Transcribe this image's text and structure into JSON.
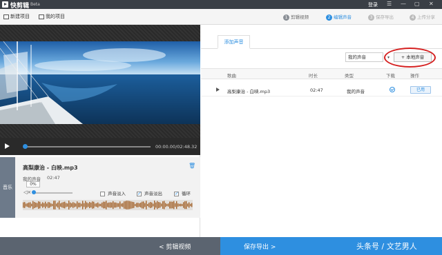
{
  "titlebar": {
    "app_name": "快剪辑",
    "badge": "Beta",
    "login": "登录",
    "controls": [
      "☰",
      "—",
      "▢",
      "✕"
    ]
  },
  "toolbar": {
    "new_project": "新建项目",
    "my_projects": "我的项目",
    "steps": [
      {
        "num": "1",
        "label": "剪辑视频",
        "state": "done"
      },
      {
        "num": "2",
        "label": "编辑声音",
        "state": "active"
      },
      {
        "num": "3",
        "label": "保存导出",
        "state": "disabled"
      },
      {
        "num": "4",
        "label": "上传分享",
        "state": "disabled"
      }
    ]
  },
  "player": {
    "time": "00:00.00/02:48.32"
  },
  "music_card": {
    "tab_label": "音乐",
    "title": "高梨康治 - 白映.mp3",
    "source": "我的声音",
    "duration": "02:47",
    "volume": "0%",
    "fade_in": {
      "label": "声音淡入",
      "checked": false
    },
    "fade_out": {
      "label": "声音淡出",
      "checked": true
    },
    "loop": {
      "label": "循环",
      "checked": true
    }
  },
  "right": {
    "tab": "添加声音",
    "filter_value": "我的声音",
    "local_button": "+ 本地声音",
    "columns": [
      "歌曲",
      "时长",
      "类型",
      "下载",
      "操作"
    ],
    "rows": [
      {
        "name": "高梨康治 - 白映.mp3",
        "duration": "02:47",
        "type": "我的声音",
        "action": "已用"
      }
    ]
  },
  "bottom": {
    "back": "< 剪辑视频",
    "next": "保存导出 >"
  },
  "watermark": "头条号 / 文艺男人",
  "colors": {
    "accent": "#2e8fe0",
    "highlight_ring": "#d52020",
    "titlebar": "#3a3f46"
  }
}
